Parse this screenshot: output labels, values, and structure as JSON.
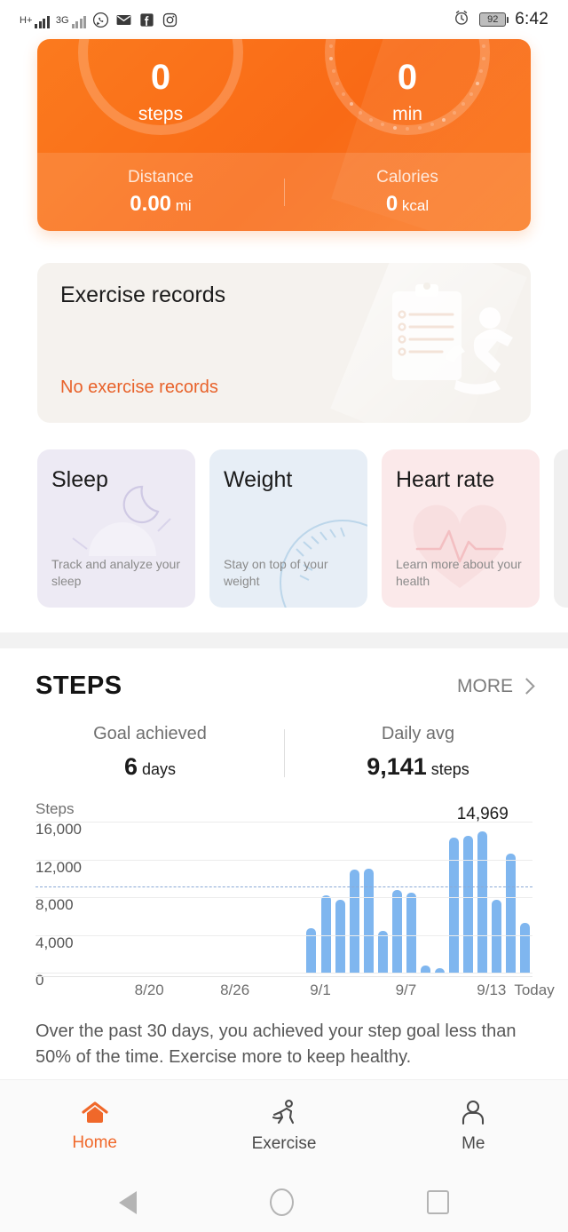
{
  "status_bar": {
    "network_type": "H+",
    "network_type_2": "3G",
    "app_icons": [
      "whatsapp-icon",
      "email-icon",
      "facebook-icon",
      "instagram-icon"
    ],
    "alarm_icon": "alarm-icon",
    "battery_level": "92",
    "time": "6:42"
  },
  "hero": {
    "steps": {
      "value": "0",
      "unit": "steps"
    },
    "active_min": {
      "value": "0",
      "unit": "min"
    },
    "distance": {
      "label": "Distance",
      "value": "0.00",
      "unit": "mi"
    },
    "calories": {
      "label": "Calories",
      "value": "0",
      "unit": "kcal"
    },
    "accent_color": "#f96a16"
  },
  "exercise_records": {
    "title": "Exercise records",
    "empty_text": "No exercise records",
    "empty_text_color": "#e8622a",
    "background_color": "#f5f2ee"
  },
  "feature_cards": [
    {
      "title": "Sleep",
      "desc": "Track and analyze your sleep",
      "color": "#edeaf4"
    },
    {
      "title": "Weight",
      "desc": "Stay on top of your weight",
      "color": "#e7eef6"
    },
    {
      "title": "Heart rate",
      "desc": "Learn more about your health",
      "color": "#fbe9ea"
    }
  ],
  "steps_section": {
    "title": "STEPS",
    "more_label": "MORE",
    "goal_achieved": {
      "label": "Goal achieved",
      "value": "6",
      "unit": "days"
    },
    "daily_avg": {
      "label": "Daily avg",
      "value": "9,141",
      "unit": "steps"
    },
    "summary": "Over the past 30 days, you achieved your step goal less than 50% of the time. Exercise more to keep healthy."
  },
  "chart_data": {
    "type": "bar",
    "title": "",
    "ylabel": "Steps",
    "xlabel": "",
    "ylim": [
      0,
      16000
    ],
    "yticks": [
      0,
      4000,
      8000,
      12000,
      16000
    ],
    "ytick_labels": [
      "0",
      "4,000",
      "8,000",
      "12,000",
      "16,000"
    ],
    "xtick_labels": [
      "8/20",
      "8/26",
      "9/1",
      "9/7",
      "9/13",
      "Today"
    ],
    "xtick_positions": [
      3,
      9,
      15,
      21,
      27,
      30
    ],
    "goal_line": 9141,
    "goal_line_color": "#8aa9d6",
    "bar_color": "#7fb6ef",
    "grid": true,
    "legend": "none",
    "max_label": "14,969",
    "total_slots": 30,
    "values": [
      null,
      null,
      null,
      null,
      null,
      null,
      null,
      null,
      null,
      null,
      null,
      null,
      null,
      null,
      4700,
      8200,
      7700,
      10900,
      11000,
      4400,
      8800,
      8500,
      800,
      500,
      14300,
      14500,
      14969,
      7700,
      12600,
      5300
    ],
    "categories": [
      "8/17",
      "8/18",
      "8/19",
      "8/20",
      "8/21",
      "8/22",
      "8/23",
      "8/24",
      "8/25",
      "8/26",
      "8/27",
      "8/28",
      "8/29",
      "8/30",
      "8/31",
      "9/1",
      "9/2",
      "9/3",
      "9/4",
      "9/5",
      "9/6",
      "9/7",
      "9/8",
      "9/9",
      "9/10",
      "9/11",
      "9/12",
      "9/13",
      "9/14",
      "Today"
    ]
  },
  "tabbar": {
    "items": [
      {
        "label": "Home",
        "icon": "home-icon",
        "active": true
      },
      {
        "label": "Exercise",
        "icon": "runner-icon",
        "active": false
      },
      {
        "label": "Me",
        "icon": "person-icon",
        "active": false
      }
    ],
    "active_color": "#f0682a"
  },
  "navbar": {
    "back": "back-triangle-icon",
    "home": "home-circle-icon",
    "recents": "recents-square-icon"
  }
}
